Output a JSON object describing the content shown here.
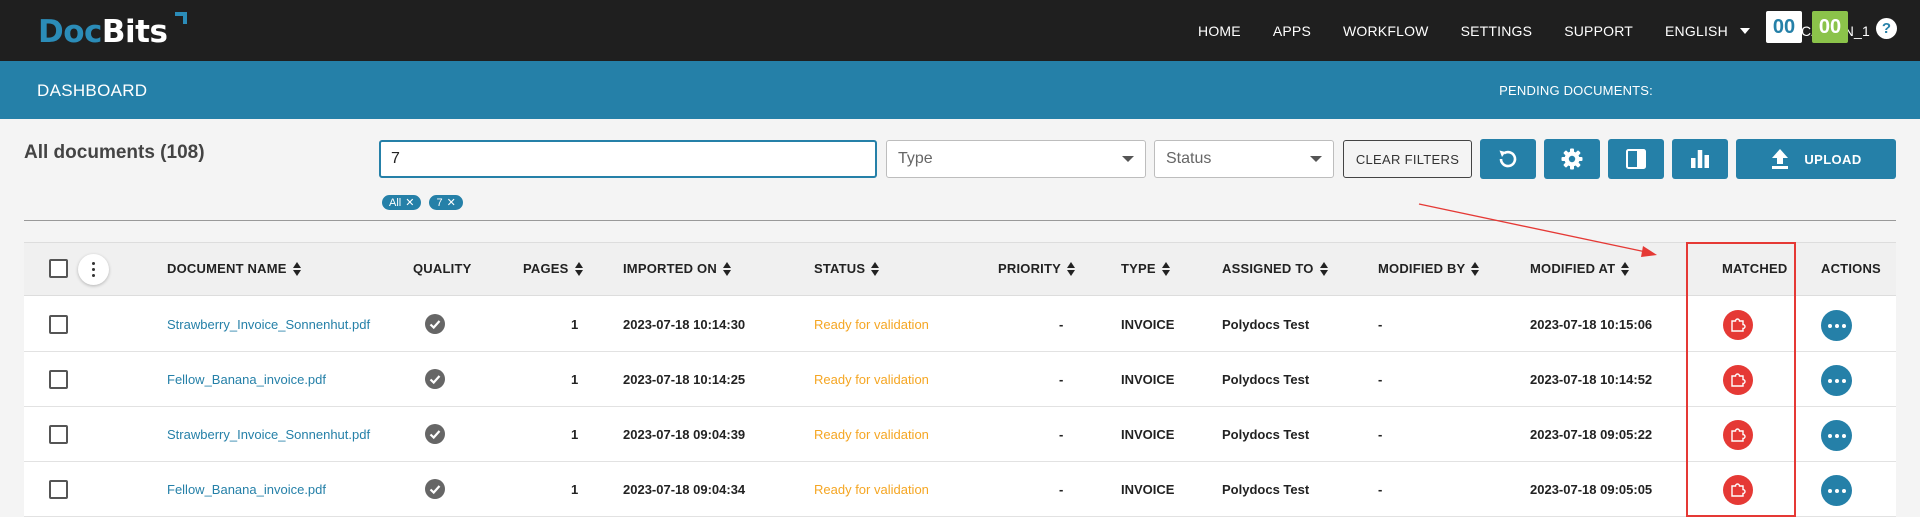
{
  "brand": {
    "name_part1": "Doc",
    "name_part2": "Bits",
    "logo_accent": "#2b8cb8"
  },
  "nav": {
    "items": [
      "HOME",
      "APPS",
      "WORKFLOW",
      "SETTINGS",
      "SUPPORT"
    ],
    "language": "ENGLISH",
    "location": "LOCATION_1"
  },
  "dashboard": {
    "title": "DASHBOARD",
    "pending_label": "PENDING DOCUMENTS:",
    "pending_a": "00",
    "pending_b": "00",
    "help": "?"
  },
  "filters": {
    "heading": "All documents (108)",
    "search_value": "7",
    "type_placeholder": "Type",
    "status_placeholder": "Status",
    "clear_label": "CLEAR FILTERS",
    "upload_label": "UPLOAD",
    "chips": [
      "All",
      "7"
    ]
  },
  "table": {
    "headers": {
      "name": "DOCUMENT NAME",
      "quality": "QUALITY",
      "pages": "PAGES",
      "imported": "IMPORTED ON",
      "status": "STATUS",
      "priority": "PRIORITY",
      "type": "TYPE",
      "assigned": "ASSIGNED TO",
      "modified_by": "MODIFIED BY",
      "modified_at": "MODIFIED AT",
      "matched": "MATCHED",
      "actions": "ACTIONS"
    },
    "rows": [
      {
        "name": "Strawberry_Invoice_Sonnenhut.pdf",
        "pages": "1",
        "imported": "2023-07-18 10:14:30",
        "status": "Ready for validation",
        "priority": "-",
        "type": "INVOICE",
        "assigned": "Polydocs Test",
        "modified_by": "-",
        "modified_at": "2023-07-18 10:15:06"
      },
      {
        "name": "Fellow_Banana_invoice.pdf",
        "pages": "1",
        "imported": "2023-07-18 10:14:25",
        "status": "Ready for validation",
        "priority": "-",
        "type": "INVOICE",
        "assigned": "Polydocs Test",
        "modified_by": "-",
        "modified_at": "2023-07-18 10:14:52"
      },
      {
        "name": "Strawberry_Invoice_Sonnenhut.pdf",
        "pages": "1",
        "imported": "2023-07-18 09:04:39",
        "status": "Ready for validation",
        "priority": "-",
        "type": "INVOICE",
        "assigned": "Polydocs Test",
        "modified_by": "-",
        "modified_at": "2023-07-18 09:05:22"
      },
      {
        "name": "Fellow_Banana_invoice.pdf",
        "pages": "1",
        "imported": "2023-07-18 09:04:34",
        "status": "Ready for validation",
        "priority": "-",
        "type": "INVOICE",
        "assigned": "Polydocs Test",
        "modified_by": "-",
        "modified_at": "2023-07-18 09:05:05"
      }
    ]
  },
  "colors": {
    "primary": "#2580a8",
    "status_ready": "#f5a623",
    "matched_red": "#e53935",
    "pending_green": "#8bc34a"
  }
}
